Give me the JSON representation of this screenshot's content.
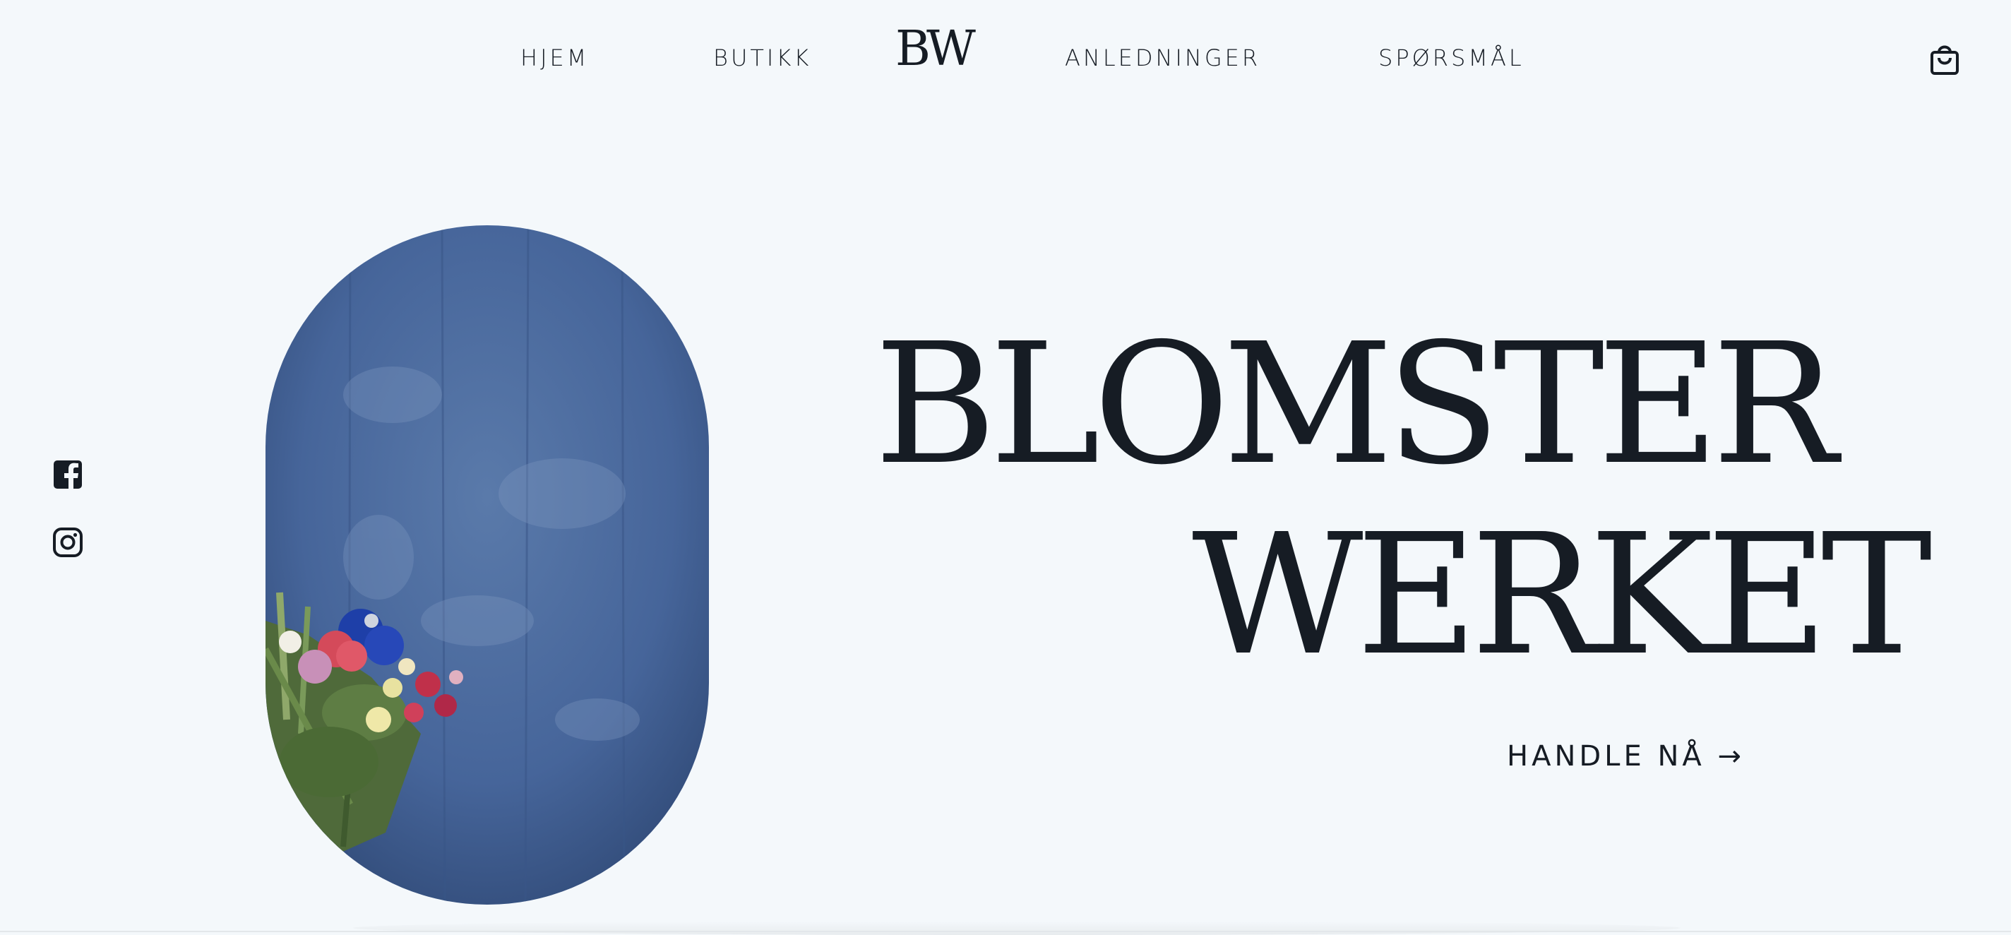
{
  "nav": {
    "items": [
      {
        "label": "HJEM"
      },
      {
        "label": "BUTIKK"
      },
      {
        "label": "ANLEDNINGER"
      },
      {
        "label": "SPØRSMÅL"
      }
    ],
    "logo": "BW",
    "cart_icon": "shopping-bag-icon"
  },
  "social": {
    "items": [
      {
        "icon": "facebook-icon"
      },
      {
        "icon": "instagram-icon"
      }
    ]
  },
  "hero": {
    "title_line_1": "BLOMSTER",
    "title_line_2": "WERKET",
    "cta_label": "HANDLE NÅ →"
  },
  "colors": {
    "background": "#f4f8fb",
    "text": "#161c24",
    "oval_blue": "#4a6a9a"
  }
}
